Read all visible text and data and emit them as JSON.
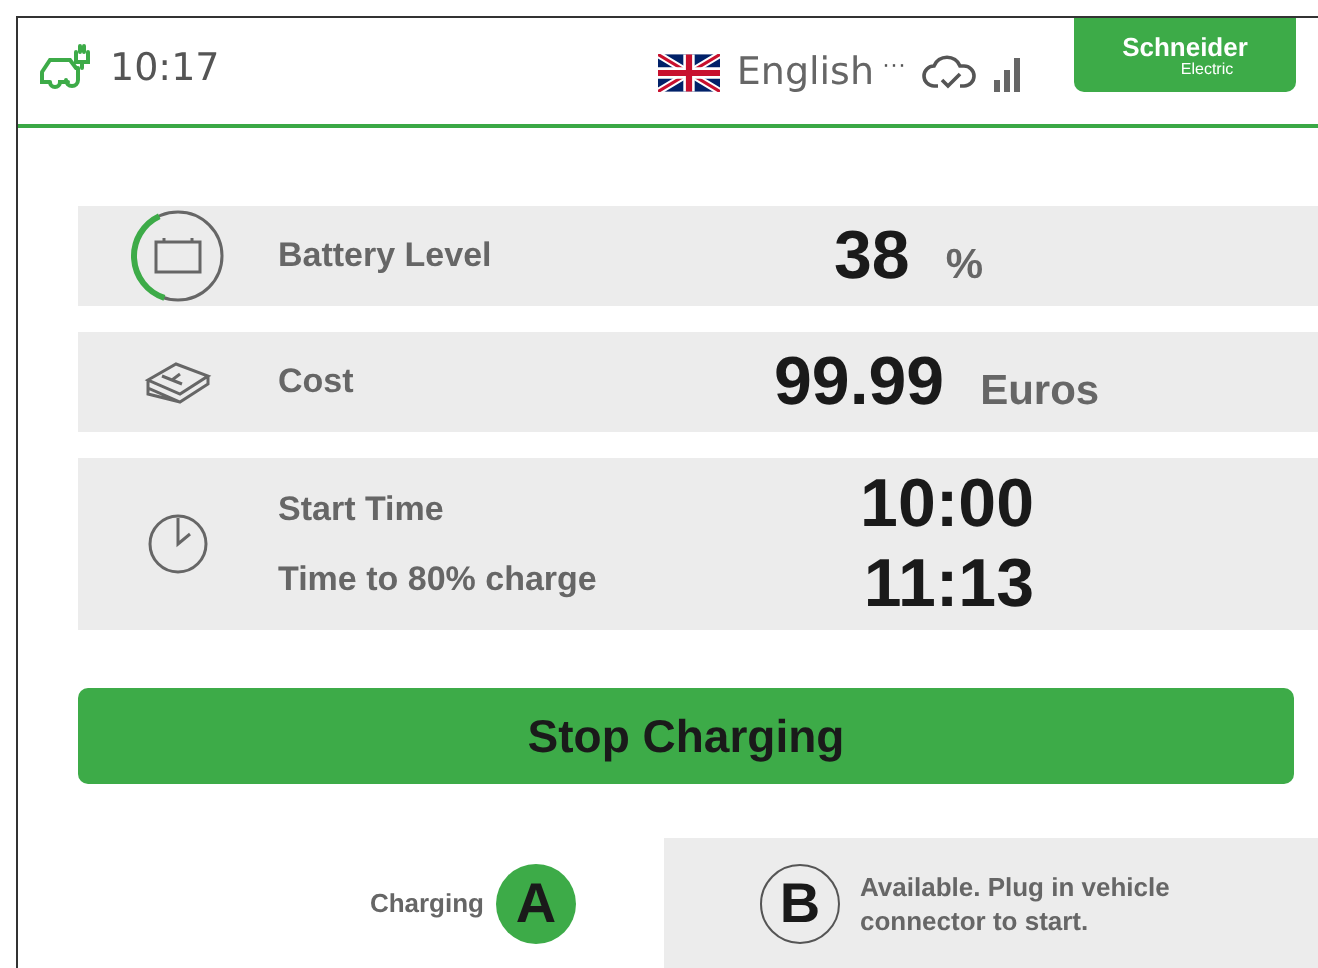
{
  "header": {
    "time": "10:17",
    "language": "English",
    "language_more": "···",
    "logo": {
      "name": "Schneider",
      "sub": "Electric"
    }
  },
  "metrics": [
    {
      "kind": "battery",
      "label": "Battery Level",
      "value": "38",
      "unit": "%",
      "level": 0.38
    },
    {
      "kind": "cost",
      "label": "Cost",
      "value": "99.99",
      "unit": "Euros"
    },
    {
      "kind": "time",
      "rows": [
        {
          "label": "Start Time",
          "value": "10:00"
        },
        {
          "label": "Time to 80% charge",
          "value": "11:13"
        }
      ]
    }
  ],
  "stop_button": "Stop Charging",
  "connectors": [
    {
      "letter": "A",
      "status": "Charging",
      "selected": true
    },
    {
      "letter": "B",
      "status": "Available. Plug in vehicle connector to start.",
      "selected": false
    }
  ]
}
